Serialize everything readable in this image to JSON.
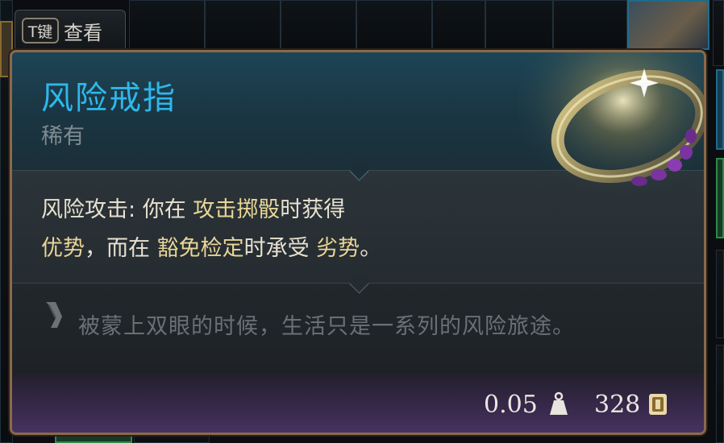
{
  "hint": {
    "key": "T键",
    "label": "查看"
  },
  "item": {
    "name": "风险戒指",
    "rarity": "稀有",
    "ability_name": "风险攻击:",
    "desc_1": "你在",
    "kw_attack": "攻击掷骰",
    "desc_2": "时获得",
    "kw_advantage": "优势",
    "desc_3": "，而在",
    "kw_save": "豁免检定",
    "desc_4": "时承受",
    "kw_disadvantage": "劣势",
    "desc_5": "。",
    "flavor": "被蒙上双眼的时候，生活只是一系列的风险旅途。",
    "weight": "0.05",
    "price": "328"
  },
  "icons": {
    "item_image": "ring-icon",
    "flavor": "scroll-icon",
    "weight": "weight-icon",
    "price": "gold-coin-icon"
  },
  "colors": {
    "title": "#2fb7ea",
    "rarity": "#7f8b91",
    "keyword": "#e9d596",
    "frame": "#8a6a4c"
  }
}
